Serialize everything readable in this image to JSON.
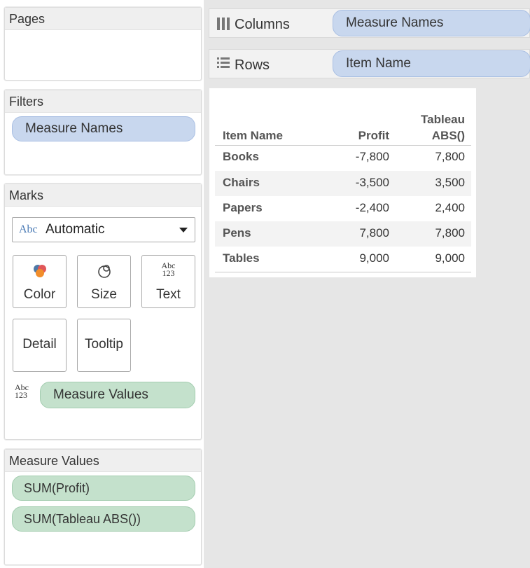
{
  "pages": {
    "title": "Pages"
  },
  "filters": {
    "title": "Filters",
    "pill": "Measure Names"
  },
  "marks": {
    "title": "Marks",
    "mark_type": {
      "icon_text": "Abc",
      "label": "Automatic"
    },
    "buttons": [
      {
        "label": "Color",
        "icon": "color-icon"
      },
      {
        "label": "Size",
        "icon": "size-icon"
      },
      {
        "label": "Text",
        "icon": "text-icon",
        "icon_top": "Abc",
        "icon_bottom": "123"
      },
      {
        "label": "Detail",
        "icon": "detail-icon"
      },
      {
        "label": "Tooltip",
        "icon": "tooltip-icon"
      }
    ],
    "field": {
      "icon_top": "Abc",
      "icon_bottom": "123",
      "label": "Measure Values"
    }
  },
  "measure_values": {
    "title": "Measure Values",
    "items": [
      "SUM(Profit)",
      "SUM(Tableau ABS())"
    ]
  },
  "columns_shelf": {
    "label": "Columns",
    "pill": "Measure Names"
  },
  "rows_shelf": {
    "label": "Rows",
    "pill": "Item Name"
  },
  "table": {
    "headers": {
      "item": "Item Name",
      "profit": "Profit",
      "abs_line1": "Tableau",
      "abs_line2": "ABS()"
    },
    "rows": [
      {
        "item": "Books",
        "profit": "-7,800",
        "abs": "7,800"
      },
      {
        "item": "Chairs",
        "profit": "-3,500",
        "abs": "3,500"
      },
      {
        "item": "Papers",
        "profit": "-2,400",
        "abs": "2,400"
      },
      {
        "item": "Pens",
        "profit": "7,800",
        "abs": "7,800"
      },
      {
        "item": "Tables",
        "profit": "9,000",
        "abs": "9,000"
      }
    ]
  },
  "colors": {
    "pill_blue": "#c8d7ee",
    "pill_green": "#c4e1cc",
    "canvas_bg": "#e6e6e6"
  }
}
